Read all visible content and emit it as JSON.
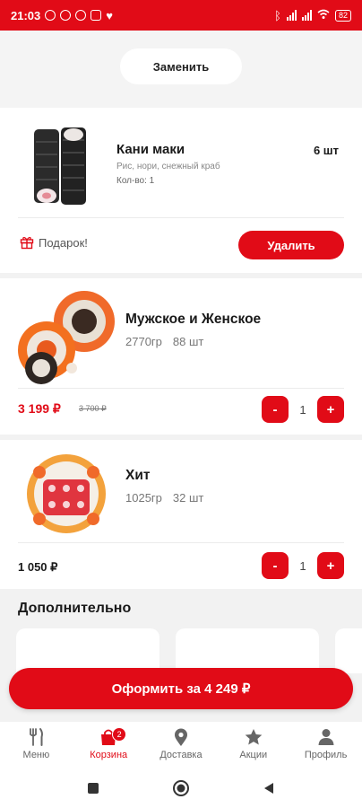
{
  "status_bar": {
    "time": "21:03",
    "battery": "82"
  },
  "replace_label": "Заменить",
  "gift_item": {
    "name": "Кани маки",
    "quantity": "6 шт",
    "description": "Рис, нори, снежный краб",
    "count": "Кол-во: 1",
    "gift_label": "Подарок!",
    "delete_label": "Удалить"
  },
  "products": [
    {
      "name": "Мужское и Женское",
      "weight": "2770гр",
      "pieces": "88 шт",
      "price": "3 199 ₽",
      "old_price": "3 700 ₽",
      "qty": "1"
    },
    {
      "name": "Хит",
      "weight": "1025гр",
      "pieces": "32 шт",
      "price": "1 050 ₽",
      "qty": "1"
    }
  ],
  "stepper": {
    "minus": "-",
    "plus": "+"
  },
  "extra_title": "Дополнительно",
  "checkout_label": "Оформить за 4 249 ₽",
  "nav": {
    "items": [
      {
        "label": "Меню",
        "icon": "fork-knife-icon"
      },
      {
        "label": "Корзина",
        "icon": "bag-icon",
        "badge": "2"
      },
      {
        "label": "Доставка",
        "icon": "location-pin-icon"
      },
      {
        "label": "Акции",
        "icon": "star-icon"
      },
      {
        "label": "Профиль",
        "icon": "person-icon"
      }
    ]
  },
  "colors": {
    "accent": "#e10b17",
    "background": "#f2f2f2"
  }
}
